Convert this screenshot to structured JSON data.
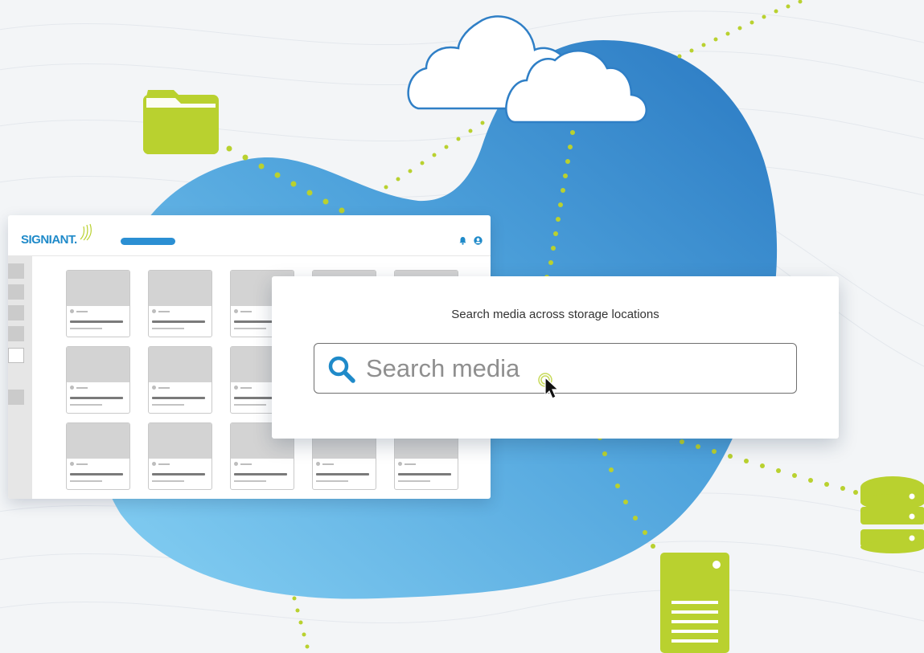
{
  "app": {
    "logo_text": "SIGNIANT",
    "logo_trademark": "."
  },
  "search": {
    "caption": "Search media across storage locations",
    "placeholder": "Search media"
  },
  "icons": {
    "folder": "folder-icon",
    "cloud": "cloud-icon",
    "database": "database-icon",
    "server": "server-icon",
    "search": "search-icon",
    "cursor": "pointer-cursor-icon",
    "bell": "bell-icon",
    "user": "user-icon"
  },
  "colors": {
    "accent_blue": "#2b8fd3",
    "lime": "#b9d12f",
    "blob_light": "#7cc6ee",
    "blob_dark": "#2f7fc6"
  }
}
